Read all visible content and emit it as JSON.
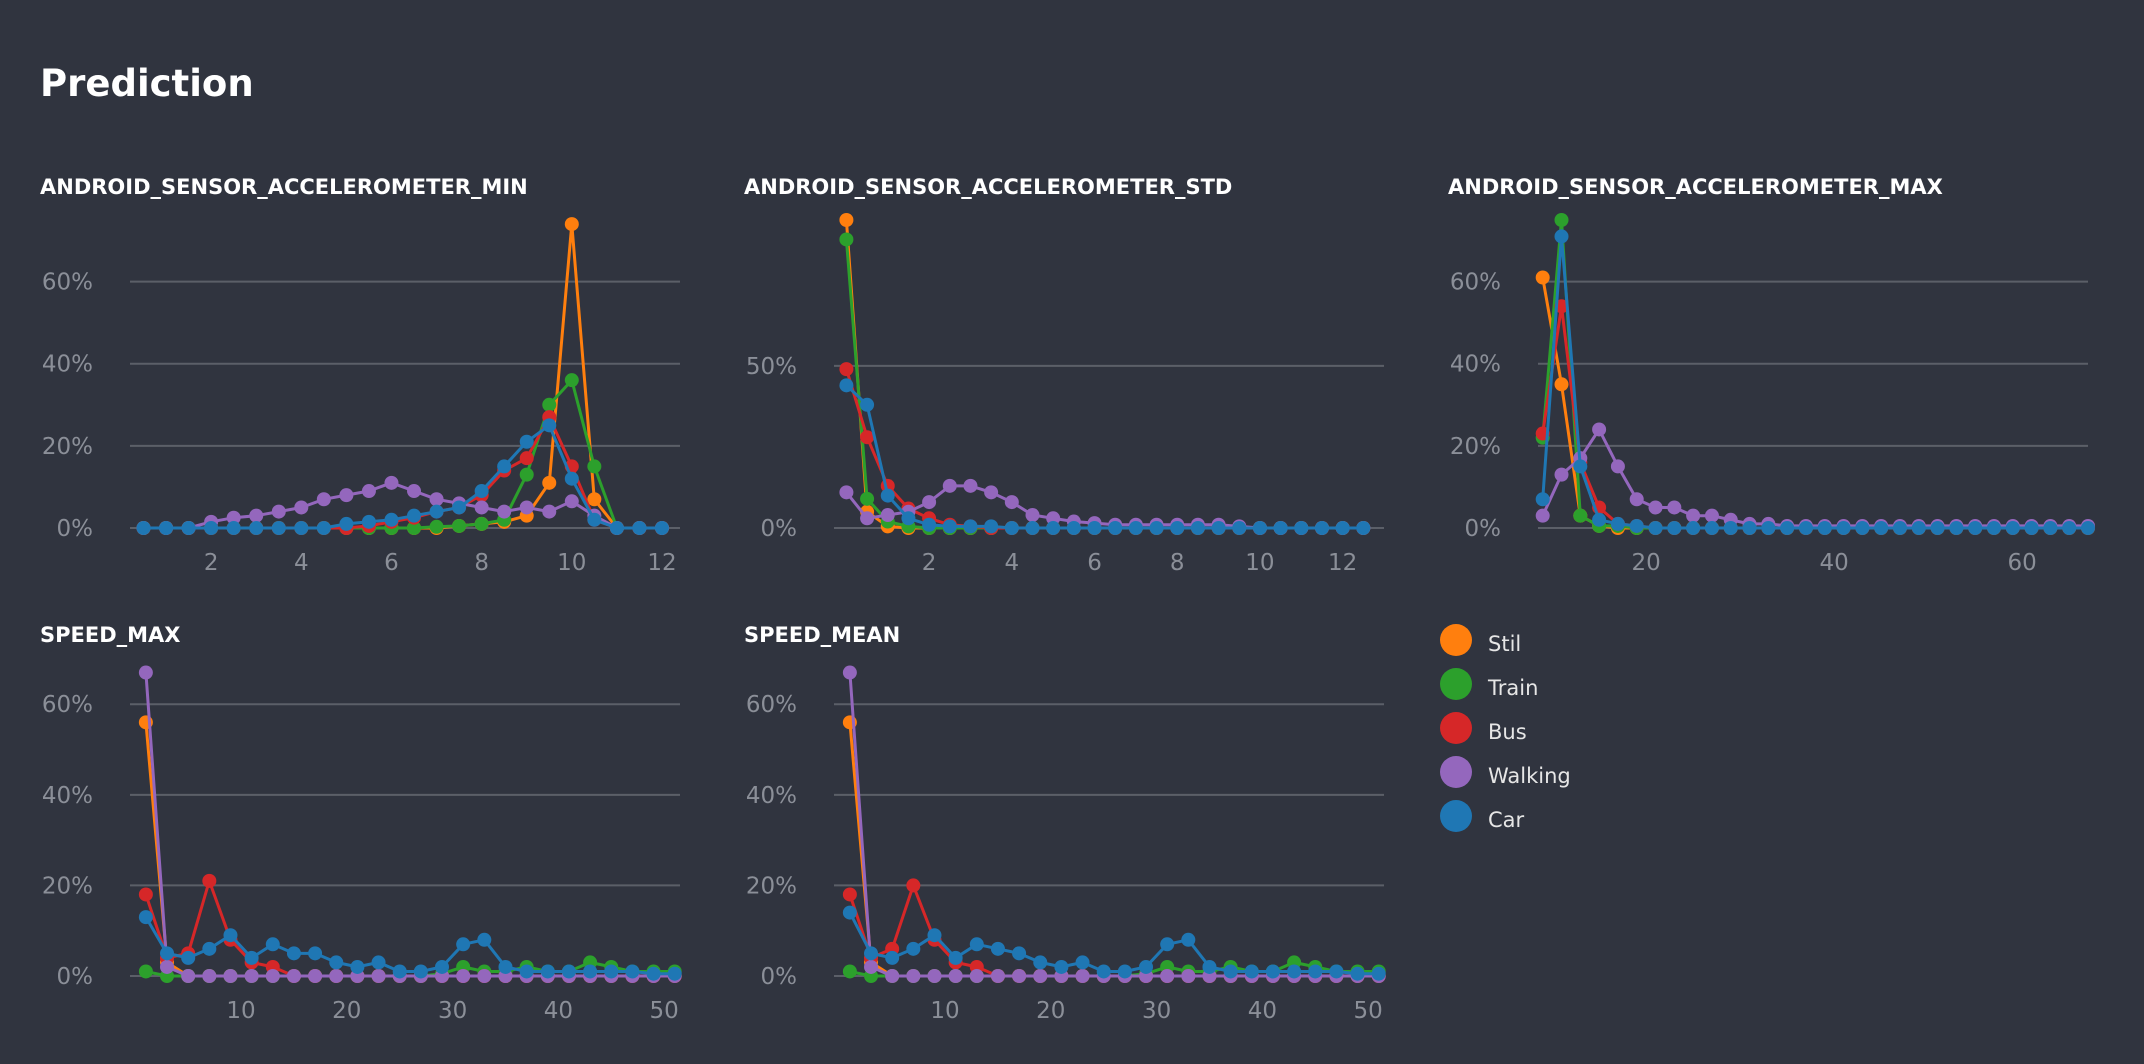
{
  "page": {
    "title": "Prediction"
  },
  "legend": [
    {
      "name": "Stil",
      "color": "#ff7f0e"
    },
    {
      "name": "Train",
      "color": "#2ca02c"
    },
    {
      "name": "Bus",
      "color": "#d62728"
    },
    {
      "name": "Walking",
      "color": "#9467bd"
    },
    {
      "name": "Car",
      "color": "#1f77b4"
    }
  ],
  "chart_data": [
    {
      "type": "line",
      "title": "ANDROID_SENSOR_ACCELEROMETER_MIN",
      "xlim": [
        0.2,
        12.4
      ],
      "ylim": [
        0,
        75
      ],
      "yticks": [
        0,
        20,
        40,
        60
      ],
      "xticks": [
        2,
        4,
        6,
        8,
        10,
        12
      ],
      "ytick_format": "percent",
      "x": [
        0.5,
        1,
        1.5,
        2,
        2.5,
        3,
        3.5,
        4,
        4.5,
        5,
        5.5,
        6,
        6.5,
        7,
        7.5,
        8,
        8.5,
        9,
        9.5,
        10,
        10.5,
        11,
        11.5,
        12
      ],
      "series": [
        {
          "name": "Stil",
          "color": "#ff7f0e",
          "values": [
            0,
            0,
            0,
            0,
            0,
            0,
            0,
            0,
            0,
            0,
            0,
            0,
            0,
            0,
            0.5,
            1,
            1.5,
            3,
            11,
            74,
            7,
            0,
            0,
            0
          ]
        },
        {
          "name": "Train",
          "color": "#2ca02c",
          "values": [
            0,
            0,
            0,
            0,
            0,
            0,
            0,
            0,
            0,
            0,
            0,
            0,
            0,
            0.3,
            0.5,
            1,
            2,
            13,
            30,
            36,
            15,
            0,
            0,
            0
          ]
        },
        {
          "name": "Bus",
          "color": "#d62728",
          "values": [
            0,
            0,
            0,
            0,
            0,
            0,
            0,
            0,
            0,
            0,
            0.5,
            1.5,
            2.5,
            4,
            5,
            8,
            14,
            17,
            27,
            15,
            2,
            0,
            0,
            0
          ]
        },
        {
          "name": "Walking",
          "color": "#9467bd",
          "values": [
            0,
            0,
            0,
            1.5,
            2.5,
            3,
            4,
            5,
            7,
            8,
            9,
            11,
            9,
            7,
            6,
            5,
            4,
            5,
            4,
            6.5,
            3,
            0,
            0,
            0
          ]
        },
        {
          "name": "Car",
          "color": "#1f77b4",
          "values": [
            0,
            0,
            0,
            0,
            0,
            0,
            0,
            0,
            0,
            1,
            1.5,
            2,
            3,
            4,
            5,
            9,
            15,
            21,
            25,
            12,
            2,
            0,
            0,
            0
          ]
        }
      ]
    },
    {
      "type": "line",
      "title": "ANDROID_SENSOR_ACCELEROMETER_STD",
      "xlim": [
        -0.3,
        13
      ],
      "ylim": [
        0,
        95
      ],
      "yticks": [
        0,
        50
      ],
      "xticks": [
        2,
        4,
        6,
        8,
        10,
        12
      ],
      "ytick_format": "percent",
      "x": [
        0,
        0.5,
        1,
        1.5,
        2,
        2.5,
        3,
        3.5,
        4,
        4.5,
        5,
        5.5,
        6,
        6.5,
        7,
        7.5,
        8,
        8.5,
        9,
        9.5,
        10,
        10.5,
        11,
        11.5,
        12,
        12.5
      ],
      "series": [
        {
          "name": "Stil",
          "color": "#ff7f0e",
          "values": [
            95,
            5,
            0.5,
            0,
            0,
            0,
            0,
            0,
            0,
            0,
            0,
            0,
            0,
            0,
            0,
            0,
            0,
            0,
            0,
            0,
            0,
            0,
            0,
            0,
            0,
            0
          ]
        },
        {
          "name": "Train",
          "color": "#2ca02c",
          "values": [
            89,
            9,
            2,
            0.5,
            0,
            0,
            0,
            0,
            0,
            0,
            0,
            0,
            0,
            0,
            0,
            0,
            0,
            0,
            0,
            0,
            0,
            0,
            0,
            0,
            0,
            0
          ]
        },
        {
          "name": "Bus",
          "color": "#d62728",
          "values": [
            49,
            28,
            13,
            6,
            3,
            1,
            0.5,
            0,
            0,
            0,
            0,
            0,
            0,
            0,
            0,
            0,
            0,
            0,
            0,
            0,
            0,
            0,
            0,
            0,
            0,
            0
          ]
        },
        {
          "name": "Walking",
          "color": "#9467bd",
          "values": [
            11,
            3,
            4,
            5,
            8,
            13,
            13,
            11,
            8,
            4,
            3,
            2,
            1.5,
            1,
            1,
            1,
            1,
            1,
            1,
            0.5,
            0,
            0,
            0,
            0,
            0,
            0
          ]
        },
        {
          "name": "Car",
          "color": "#1f77b4",
          "values": [
            44,
            38,
            10,
            3,
            1,
            0.5,
            0.5,
            0.5,
            0,
            0,
            0,
            0,
            0,
            0,
            0,
            0,
            0,
            0,
            0,
            0,
            0,
            0,
            0,
            0,
            0,
            0
          ]
        }
      ]
    },
    {
      "type": "line",
      "title": "ANDROID_SENSOR_ACCELEROMETER_MAX",
      "xlim": [
        8.5,
        67
      ],
      "ylim": [
        0,
        75
      ],
      "yticks": [
        0,
        20,
        40,
        60
      ],
      "xticks": [
        20,
        40,
        60
      ],
      "ytick_format": "percent",
      "x": [
        9,
        11,
        13,
        15,
        17,
        19,
        21,
        23,
        25,
        27,
        29,
        31,
        33,
        35,
        37,
        39,
        41,
        43,
        45,
        47,
        49,
        51,
        53,
        55,
        57,
        59,
        61,
        63,
        65,
        67
      ],
      "series": [
        {
          "name": "Stil",
          "color": "#ff7f0e",
          "values": [
            61,
            35,
            3,
            0.5,
            0,
            0,
            0,
            0,
            0,
            0,
            0,
            0,
            0,
            0,
            0,
            0,
            0,
            0,
            0,
            0,
            0,
            0,
            0,
            0,
            0,
            0,
            0,
            0,
            0,
            0
          ]
        },
        {
          "name": "Train",
          "color": "#2ca02c",
          "values": [
            22,
            75,
            3,
            0.5,
            0.5,
            0,
            0,
            0,
            0,
            0,
            0,
            0,
            0,
            0,
            0,
            0,
            0,
            0,
            0,
            0,
            0,
            0,
            0,
            0,
            0,
            0,
            0,
            0,
            0,
            0
          ]
        },
        {
          "name": "Bus",
          "color": "#d62728",
          "values": [
            23,
            54,
            16,
            5,
            1,
            0.5,
            0,
            0,
            0,
            0,
            0,
            0,
            0,
            0,
            0,
            0,
            0,
            0,
            0,
            0,
            0,
            0,
            0,
            0,
            0,
            0,
            0,
            0,
            0,
            0
          ]
        },
        {
          "name": "Walking",
          "color": "#9467bd",
          "values": [
            3,
            13,
            17,
            24,
            15,
            7,
            5,
            5,
            3,
            3,
            2,
            1,
            1,
            0.5,
            0.5,
            0.5,
            0.5,
            0.5,
            0.5,
            0.5,
            0.5,
            0.5,
            0.5,
            0.5,
            0.5,
            0.5,
            0.5,
            0.5,
            0.5,
            0.5
          ]
        },
        {
          "name": "Car",
          "color": "#1f77b4",
          "values": [
            7,
            71,
            15,
            2,
            1,
            0.5,
            0,
            0,
            0,
            0,
            0,
            0,
            0,
            0,
            0,
            0,
            0,
            0,
            0,
            0,
            0,
            0,
            0,
            0,
            0,
            0,
            0,
            0,
            0,
            0
          ]
        }
      ]
    },
    {
      "type": "line",
      "title": "SPEED_MAX",
      "xlim": [
        -0.5,
        51.5
      ],
      "ylim": [
        0,
        68
      ],
      "yticks": [
        0,
        20,
        40,
        60
      ],
      "xticks": [
        10,
        20,
        30,
        40,
        50
      ],
      "ytick_format": "percent",
      "x": [
        1,
        3,
        5,
        7,
        9,
        11,
        13,
        15,
        17,
        19,
        21,
        23,
        25,
        27,
        29,
        31,
        33,
        35,
        37,
        39,
        41,
        43,
        45,
        47,
        49,
        51
      ],
      "series": [
        {
          "name": "Stil",
          "color": "#ff7f0e",
          "values": [
            56,
            3,
            0,
            0,
            0,
            0,
            0,
            0,
            0,
            0,
            0,
            0,
            0,
            0,
            0,
            0,
            0,
            0,
            0,
            0,
            0,
            0,
            0,
            0,
            0,
            0
          ]
        },
        {
          "name": "Train",
          "color": "#2ca02c",
          "values": [
            1,
            0,
            0,
            0,
            0,
            0,
            0,
            0,
            0,
            0,
            0,
            0,
            0,
            0,
            0.5,
            2,
            1,
            1,
            2,
            1,
            1,
            3,
            2,
            1,
            1,
            1
          ]
        },
        {
          "name": "Bus",
          "color": "#d62728",
          "values": [
            18,
            4,
            5,
            21,
            8,
            3,
            2,
            0,
            0,
            0,
            0,
            0,
            0,
            0,
            0,
            0,
            0,
            0,
            0,
            0,
            0,
            0,
            0,
            0,
            0,
            0
          ]
        },
        {
          "name": "Walking",
          "color": "#9467bd",
          "values": [
            67,
            2,
            0,
            0,
            0,
            0,
            0,
            0,
            0,
            0,
            0,
            0,
            0,
            0,
            0,
            0,
            0,
            0,
            0,
            0,
            0,
            0,
            0,
            0,
            0,
            0
          ]
        },
        {
          "name": "Car",
          "color": "#1f77b4",
          "values": [
            13,
            5,
            4,
            6,
            9,
            4,
            7,
            5,
            5,
            3,
            2,
            3,
            1,
            1,
            2,
            7,
            8,
            2,
            1,
            1,
            1,
            1,
            1,
            1,
            0.5,
            0.5
          ]
        }
      ]
    },
    {
      "type": "line",
      "title": "SPEED_MEAN",
      "xlim": [
        -0.5,
        51.5
      ],
      "ylim": [
        0,
        68
      ],
      "yticks": [
        0,
        20,
        40,
        60
      ],
      "xticks": [
        10,
        20,
        30,
        40,
        50
      ],
      "ytick_format": "percent",
      "x": [
        1,
        3,
        5,
        7,
        9,
        11,
        13,
        15,
        17,
        19,
        21,
        23,
        25,
        27,
        29,
        31,
        33,
        35,
        37,
        39,
        41,
        43,
        45,
        47,
        49,
        51
      ],
      "series": [
        {
          "name": "Stil",
          "color": "#ff7f0e",
          "values": [
            56,
            3,
            0,
            0,
            0,
            0,
            0,
            0,
            0,
            0,
            0,
            0,
            0,
            0,
            0,
            0,
            0,
            0,
            0,
            0,
            0,
            0,
            0,
            0,
            0,
            0
          ]
        },
        {
          "name": "Train",
          "color": "#2ca02c",
          "values": [
            1,
            0,
            0,
            0,
            0,
            0,
            0,
            0,
            0,
            0,
            0,
            0,
            0,
            0,
            0.5,
            2,
            1,
            1,
            2,
            1,
            1,
            3,
            2,
            1,
            1,
            1
          ]
        },
        {
          "name": "Bus",
          "color": "#d62728",
          "values": [
            18,
            4,
            6,
            20,
            8,
            3,
            2,
            0,
            0,
            0,
            0,
            0,
            0,
            0,
            0,
            0,
            0,
            0,
            0,
            0,
            0,
            0,
            0,
            0,
            0,
            0
          ]
        },
        {
          "name": "Walking",
          "color": "#9467bd",
          "values": [
            67,
            2,
            0,
            0,
            0,
            0,
            0,
            0,
            0,
            0,
            0,
            0,
            0,
            0,
            0,
            0,
            0,
            0,
            0,
            0,
            0,
            0,
            0,
            0,
            0,
            0
          ]
        },
        {
          "name": "Car",
          "color": "#1f77b4",
          "values": [
            14,
            5,
            4,
            6,
            9,
            4,
            7,
            6,
            5,
            3,
            2,
            3,
            1,
            1,
            2,
            7,
            8,
            2,
            1,
            1,
            1,
            1,
            1,
            1,
            0.5,
            0.5
          ]
        }
      ]
    }
  ]
}
